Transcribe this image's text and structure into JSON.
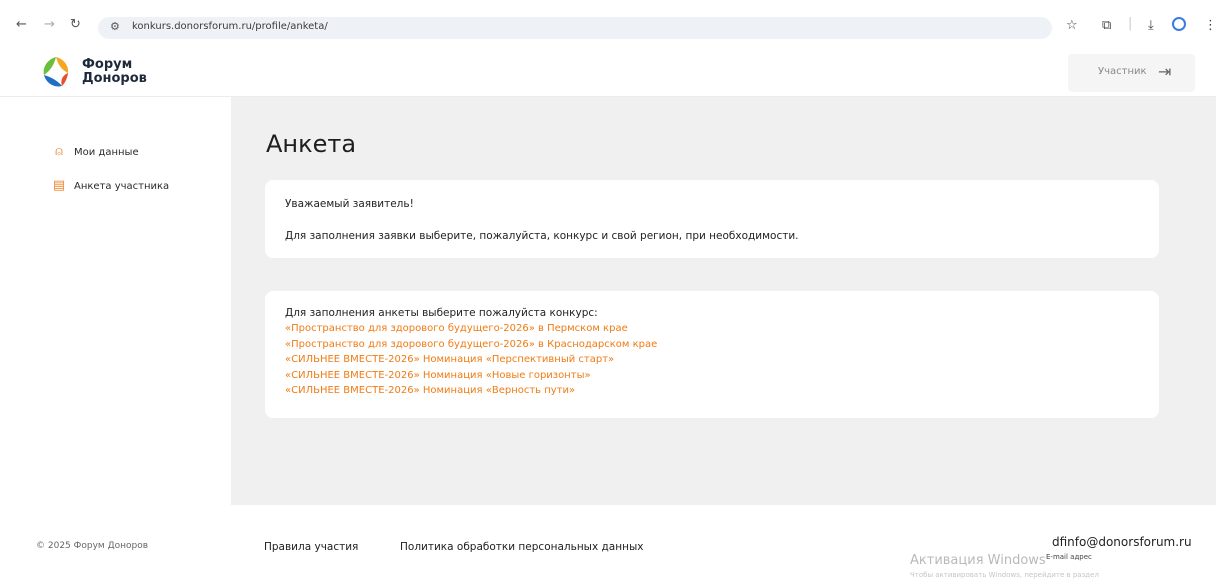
{
  "browser": {
    "url": "konkurs.donorsforum.ru/profile/anketa/"
  },
  "header": {
    "logo_line1": "Форум",
    "logo_line2": "Доноров",
    "participant_label": "Участник"
  },
  "sidebar": {
    "items": [
      {
        "label": "Мои данные",
        "icon": "user-icon"
      },
      {
        "label": "Анкета участника",
        "icon": "document-icon"
      }
    ]
  },
  "main": {
    "title": "Анкета",
    "notice": {
      "greeting": "Уважаемый заявитель!",
      "message": "Для заполнения заявки выберите, пожалуйста, конкурс и свой регион, при необходимости."
    },
    "contests": {
      "intro": "Для заполнения анкеты выберите пожалуйста конкурс:",
      "links": [
        "«Пространство для здорового будущего-2026» в Пермском крае",
        "«Пространство для здорового будущего-2026» в Краснодарском крае",
        "«СИЛЬНЕЕ ВМЕСТЕ-2026» Номинация «Перспективный старт»",
        "«СИЛЬНЕЕ ВМЕСТЕ-2026» Номинация «Новые горизонты»",
        "«СИЛЬНЕЕ ВМЕСТЕ-2026» Номинация «Верность пути»"
      ]
    }
  },
  "footer": {
    "copyright": "© 2025 Форум Доноров",
    "rules_link": "Правила участия",
    "policy_link": "Политика обработки персональных данных",
    "email": "dfinfo@donorsforum.ru",
    "email_caption": "E-mail адрес",
    "watermark_title": "Активация Windows",
    "watermark_sub": "Чтобы активировать Windows, перейдите в раздел"
  },
  "colors": {
    "accent": "#f07b14",
    "main_bg": "#f0f0f0"
  }
}
